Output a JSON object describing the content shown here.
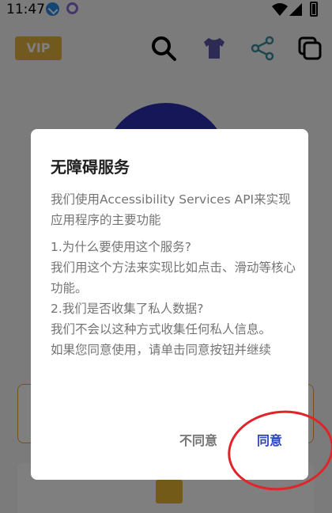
{
  "status_bar": {
    "time": "11:47",
    "icons": [
      "download-icon",
      "circle-notification-icon",
      "wifi-icon",
      "signal-icon",
      "battery-icon"
    ]
  },
  "app": {
    "vip_label": "VIP",
    "toolbar_icons": [
      "search-icon",
      "shirt-icon",
      "share-icon",
      "copy-icon"
    ],
    "accent_color": "#2b2fb0",
    "vip_color": "#e3b240"
  },
  "dialog": {
    "title": "无障碍服务",
    "paragraphs": [
      "我们使用Accessibility Services API来实现应用程序的主要功能",
      "1.为什么要使用这个服务?\n我们用这个方法来实现比如点击、滑动等核心功能。\n2.我们是否收集了私人数据?\n我们不会以这种方式收集任何私人信息。\n如果您同意使用，请单击同意按钮并继续"
    ],
    "decline_label": "不同意",
    "agree_label": "同意",
    "agree_color": "#2f46b8"
  }
}
